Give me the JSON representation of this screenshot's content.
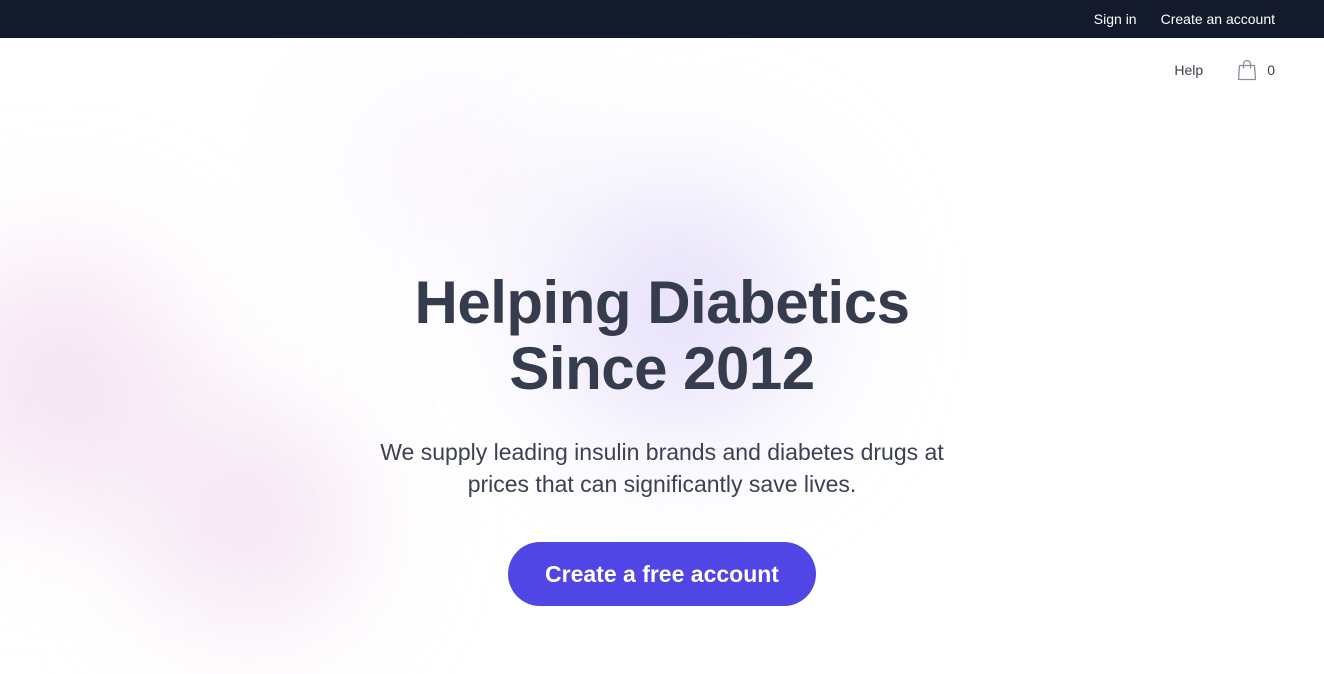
{
  "topbar": {
    "sign_in": "Sign in",
    "create_account": "Create an account"
  },
  "nav": {
    "help": "Help",
    "cart_count": "0",
    "cart_icon": "shopping-bag-icon"
  },
  "hero": {
    "headline_line1": "Helping Diabetics",
    "headline_line2": "Since 2012",
    "subtitle_line1": "We supply leading insulin brands and diabetes drugs at",
    "subtitle_line2": "prices that can significantly save lives.",
    "cta_label": "Create a free account"
  },
  "colors": {
    "topbar_bg": "#121a2c",
    "accent": "#4f46e5",
    "heading": "#353c4e"
  }
}
